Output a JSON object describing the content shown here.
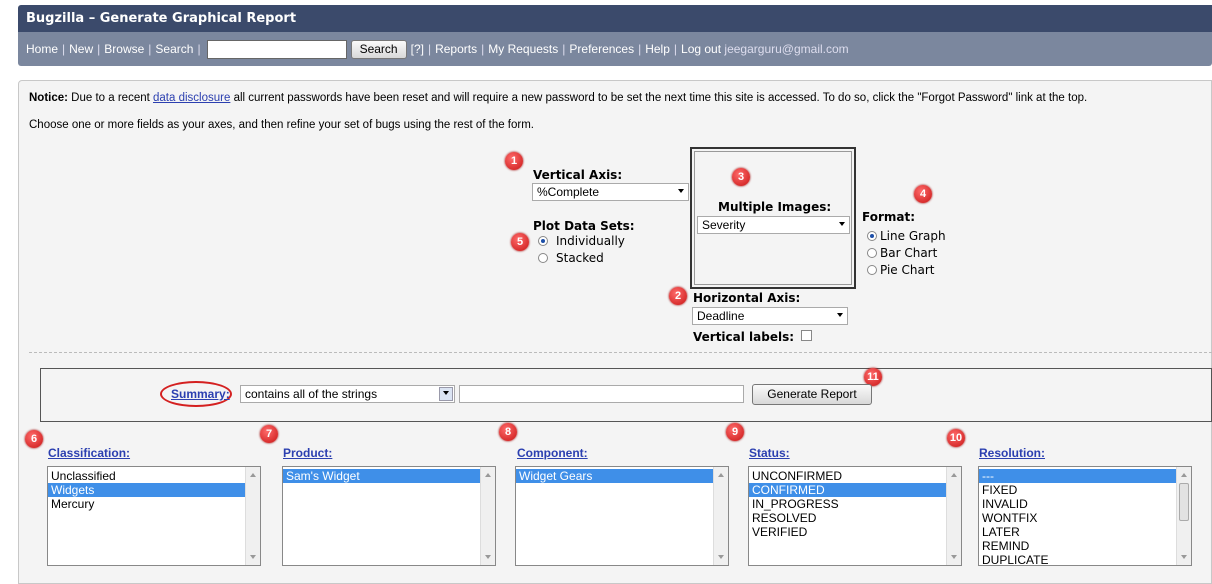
{
  "header": {
    "title": "Bugzilla – Generate Graphical Report",
    "nav": {
      "links_before": [
        "Home",
        "New",
        "Browse",
        "Search"
      ],
      "search_button": "Search",
      "help_link": "[?]",
      "links_after": [
        "Reports",
        "My Requests",
        "Preferences",
        "Help",
        "Log out"
      ],
      "user_email": "jeegarguru@gmail.com"
    }
  },
  "notice": {
    "label": "Notice:",
    "text_before": " Due to a recent ",
    "link": "data disclosure",
    "text_after": " all current passwords have been reset and will require a new password to be set the next time this site is accessed. To do so, click the \"Forgot Password\" link at the top."
  },
  "intro": "Choose one or more fields as your axes, and then refine your set of bugs using the rest of the form.",
  "axes": {
    "vertical_label": "Vertical Axis:",
    "vertical_value": "%Complete",
    "multiple_images_label": "Multiple Images:",
    "multiple_images_value": "Severity",
    "horizontal_label": "Horizontal Axis:",
    "horizontal_value": "Deadline",
    "vertical_labels_label": "Vertical labels:"
  },
  "plot": {
    "label": "Plot Data Sets:",
    "options": [
      "Individually",
      "Stacked"
    ],
    "selected": "Individually"
  },
  "format": {
    "label": "Format:",
    "options": [
      "Line Graph",
      "Bar Chart",
      "Pie Chart"
    ],
    "selected": "Line Graph"
  },
  "summary": {
    "label": "Summary:",
    "operator": "contains all of the strings",
    "value": "",
    "generate_button": "Generate Report"
  },
  "badges": [
    "1",
    "2",
    "3",
    "4",
    "5",
    "6",
    "7",
    "8",
    "9",
    "10",
    "11"
  ],
  "columns": {
    "classification": {
      "label": "Classification:",
      "items": [
        "Unclassified",
        "Widgets",
        "Mercury"
      ],
      "selected": [
        "Widgets"
      ]
    },
    "product": {
      "label": "Product:",
      "items": [
        "Sam's Widget"
      ],
      "selected": [
        "Sam's Widget"
      ]
    },
    "component": {
      "label": "Component:",
      "items": [
        "Widget Gears"
      ],
      "selected": [
        "Widget Gears"
      ]
    },
    "status": {
      "label": "Status:",
      "items": [
        "UNCONFIRMED",
        "CONFIRMED",
        "IN_PROGRESS",
        "RESOLVED",
        "VERIFIED"
      ],
      "selected": [
        "CONFIRMED"
      ]
    },
    "resolution": {
      "label": "Resolution:",
      "items": [
        "---",
        "FIXED",
        "INVALID",
        "WONTFIX",
        "LATER",
        "REMIND",
        "DUPLICATE"
      ],
      "selected": [
        "---"
      ]
    }
  },
  "colors": {
    "header_bg": "#3b4a6b",
    "nav_bg": "#7b879e",
    "link": "#2b3fb0",
    "selection": "#3f8fe8",
    "badge": "#d42020"
  }
}
